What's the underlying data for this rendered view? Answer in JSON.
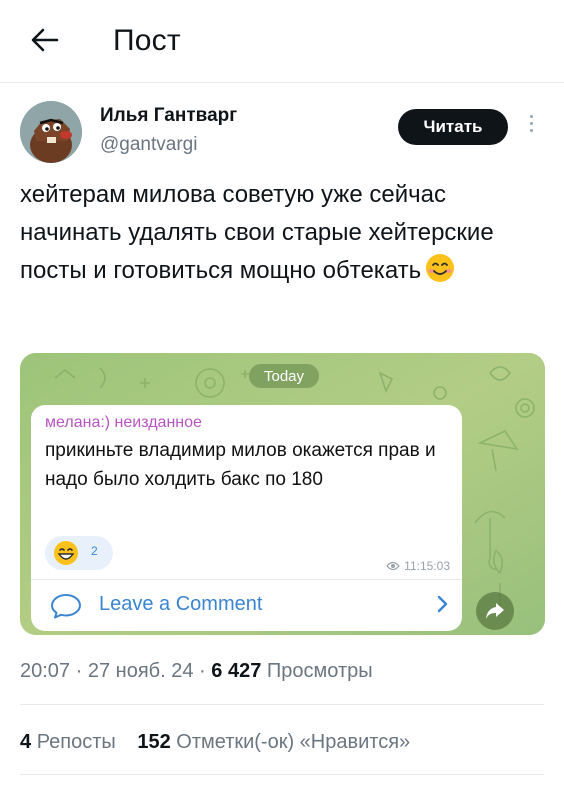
{
  "header": {
    "back_icon": "arrow-left-icon",
    "title": "Пост"
  },
  "author": {
    "name": "Илья Гантварг",
    "handle": "@gantvargi",
    "follow_label": "Читать"
  },
  "post": {
    "text": "хейтерам милова советую уже сейчас начинать удалять свои старые хейтерские посты и готовиться мощно обтекать",
    "emoji": "smiling-face-emoji"
  },
  "embedded": {
    "date_pill": "Today",
    "sender": "мелана:) неизданное",
    "text": "прикиньте владимир милов окажется прав и надо было холдить бакс по 180",
    "reaction_emoji": "grinning-face-emoji",
    "reaction_count": "2",
    "time": "11:15:03",
    "comment_label": "Leave a Comment"
  },
  "meta": {
    "time": "20:07",
    "sep1": "·",
    "date": "27 нояб. 24",
    "sep2": "·",
    "views_count": "6 427",
    "views_label": "Просмотры"
  },
  "stats": {
    "reposts_count": "4",
    "reposts_label": "Репосты",
    "likes_count": "152",
    "likes_label": "Отметки(-ок) «Нравится»"
  },
  "colors": {
    "accent": "#3a85d2",
    "sender": "#b755c0",
    "background_green": "#a6c77c",
    "button": "#0f1419"
  }
}
